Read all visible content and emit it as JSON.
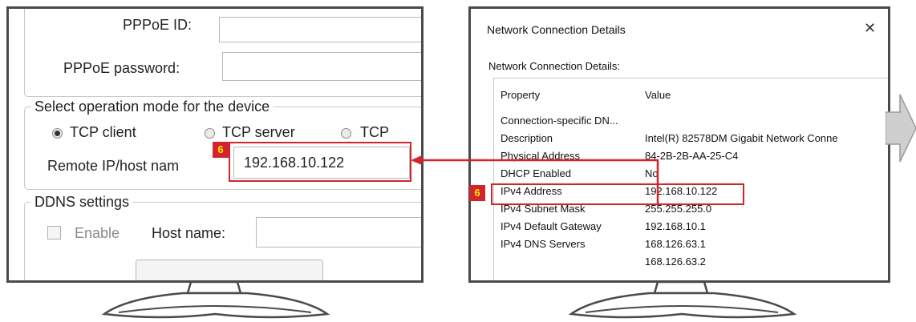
{
  "left_screen": {
    "pppoe_id_label": "PPPoE ID:",
    "pppoe_password_label": "PPPoE password:",
    "operation_mode_legend": "Select operation mode for the device",
    "radio_tcp_client": "TCP client",
    "radio_tcp_server": "TCP server",
    "radio_tcp_other": "TCP",
    "selected_mode": "TCP client",
    "remote_ip_label": "Remote IP/host nam",
    "remote_ip_value": "192.168.10.122",
    "ddns_legend": "DDNS settings",
    "enable_label": "Enable",
    "host_name_label": "Host name:"
  },
  "right_screen": {
    "window_title": "Network Connection Details",
    "close_glyph": "✕",
    "details_label": "Network Connection Details:",
    "columns": {
      "property": "Property",
      "value": "Value"
    },
    "rows": [
      {
        "property": "Connection-specific DN...",
        "value": ""
      },
      {
        "property": "Description",
        "value": "Intel(R) 82578DM Gigabit Network Conne"
      },
      {
        "property": "Physical Address",
        "value": "84-2B-2B-AA-25-C4"
      },
      {
        "property": "DHCP Enabled",
        "value": "No"
      },
      {
        "property": "IPv4 Address",
        "value": "192.168.10.122"
      },
      {
        "property": "IPv4 Subnet Mask",
        "value": "255.255.255.0"
      },
      {
        "property": "IPv4 Default Gateway",
        "value": "192.168.10.1"
      },
      {
        "property": "IPv4 DNS Servers",
        "value": "168.126.63.1"
      },
      {
        "property": "",
        "value": "168.126.63.2"
      }
    ]
  },
  "annotations": {
    "step_left": "6",
    "step_right": "6",
    "accent_color": "#d3242d",
    "badge_text_color": "#ffe800"
  }
}
